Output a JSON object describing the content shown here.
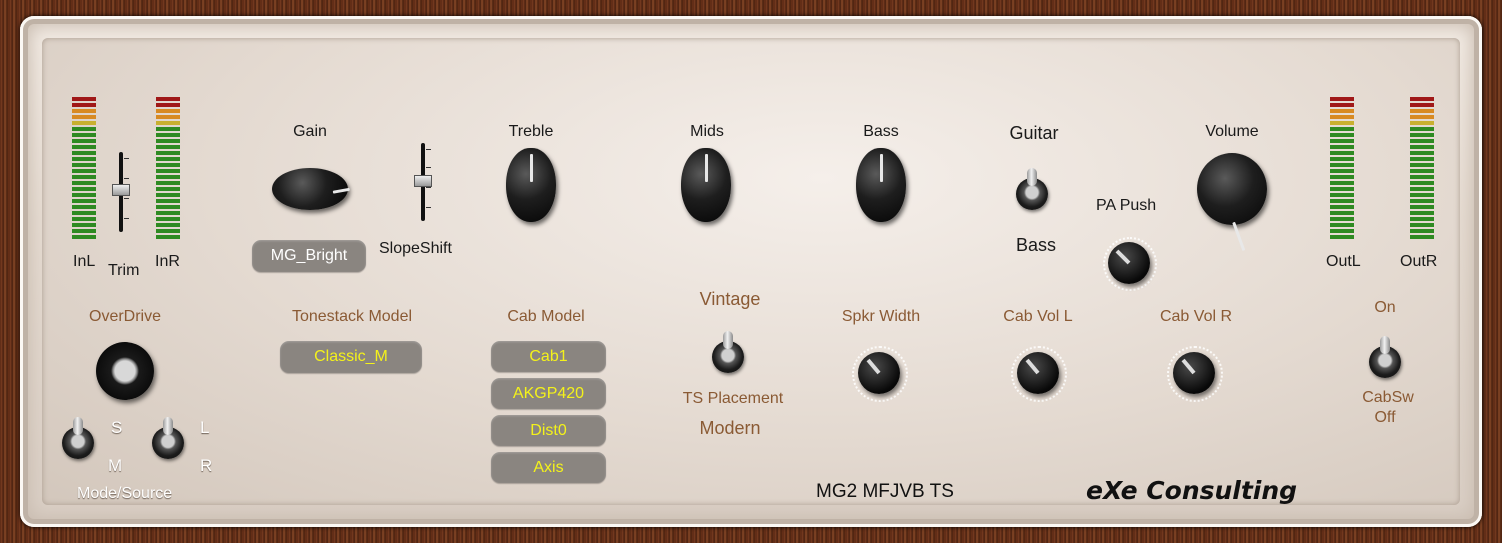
{
  "input_section": {
    "in_left_label": "InL",
    "in_right_label": "InR",
    "trim_label": "Trim"
  },
  "knobs": {
    "gain_label": "Gain",
    "slopeshift_label": "SlopeShift",
    "treble_label": "Treble",
    "mids_label": "Mids",
    "bass_label": "Bass",
    "volume_label": "Volume",
    "pa_push_label": "PA Push"
  },
  "guitar_bass_switch": {
    "top_label": "Guitar",
    "bottom_label": "Bass"
  },
  "gain_mode_value": "MG_Bright",
  "overdrive": {
    "label": "OverDrive",
    "mode_source_label": "Mode/Source",
    "switch1_top": "S",
    "switch1_bottom": "M",
    "switch2_top": "L",
    "switch2_bottom": "R"
  },
  "tonestack": {
    "label": "Tonestack Model",
    "value": "Classic_M"
  },
  "cab": {
    "label": "Cab Model",
    "options": [
      "Cab1",
      "AKGP420",
      "Dist0",
      "Axis"
    ]
  },
  "ts_placement": {
    "top_label": "Vintage",
    "label": "TS Placement",
    "bottom_label": "Modern"
  },
  "speaker": {
    "width_label": "Spkr Width",
    "cab_vol_l_label": "Cab Vol L",
    "cab_vol_r_label": "Cab Vol R"
  },
  "cab_switch": {
    "on_label": "On",
    "label": "CabSw",
    "off_label": "Off"
  },
  "output_section": {
    "out_left_label": "OutL",
    "out_right_label": "OutR"
  },
  "footer": {
    "model_name": "MG2 MFJVB TS",
    "brand": "eXe Consulting"
  },
  "colors": {
    "meter_red": "#a01818",
    "meter_orange": "#d88a22",
    "meter_yellow": "#c8b030",
    "meter_green": "#2e8a22",
    "label_brown": "#8a5a34",
    "pill_text_yellow": "#f4f21a",
    "pill_bg": "#8a8580"
  }
}
